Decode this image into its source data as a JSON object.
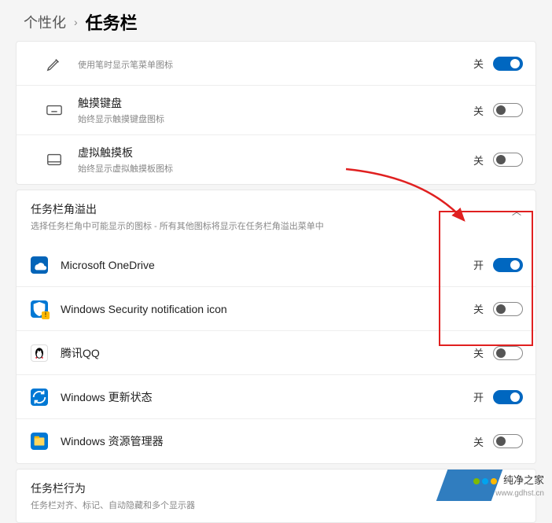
{
  "breadcrumb": {
    "parent": "个性化",
    "current": "任务栏"
  },
  "topRows": [
    {
      "icon": "pen",
      "title": "",
      "sub": "使用笔时显示笔菜单图标",
      "state": "关",
      "on": true
    },
    {
      "icon": "keyboard",
      "title": "触摸键盘",
      "sub": "始终显示触摸键盘图标",
      "state": "关",
      "on": false
    },
    {
      "icon": "touchpad",
      "title": "虚拟触摸板",
      "sub": "始终显示虚拟触摸板图标",
      "state": "关",
      "on": false
    }
  ],
  "overflowSection": {
    "title": "任务栏角溢出",
    "sub": "选择任务栏角中可能显示的图标 - 所有其他图标将显示在任务栏角溢出菜单中",
    "items": [
      {
        "icon": "onedrive",
        "label": "Microsoft OneDrive",
        "state": "开",
        "on": true
      },
      {
        "icon": "security",
        "label": "Windows Security notification icon",
        "state": "关",
        "on": false
      },
      {
        "icon": "qq",
        "label": "腾讯QQ",
        "state": "关",
        "on": false
      },
      {
        "icon": "update",
        "label": "Windows 更新状态",
        "state": "开",
        "on": true
      },
      {
        "icon": "explorer",
        "label": "Windows 资源管理器",
        "state": "关",
        "on": false
      }
    ]
  },
  "behaviorSection": {
    "title": "任务栏行为",
    "sub": "任务栏对齐、标记、自动隐藏和多个显示器"
  },
  "watermark": {
    "text": "纯净之家",
    "domain": "www.gdhst.cn"
  }
}
